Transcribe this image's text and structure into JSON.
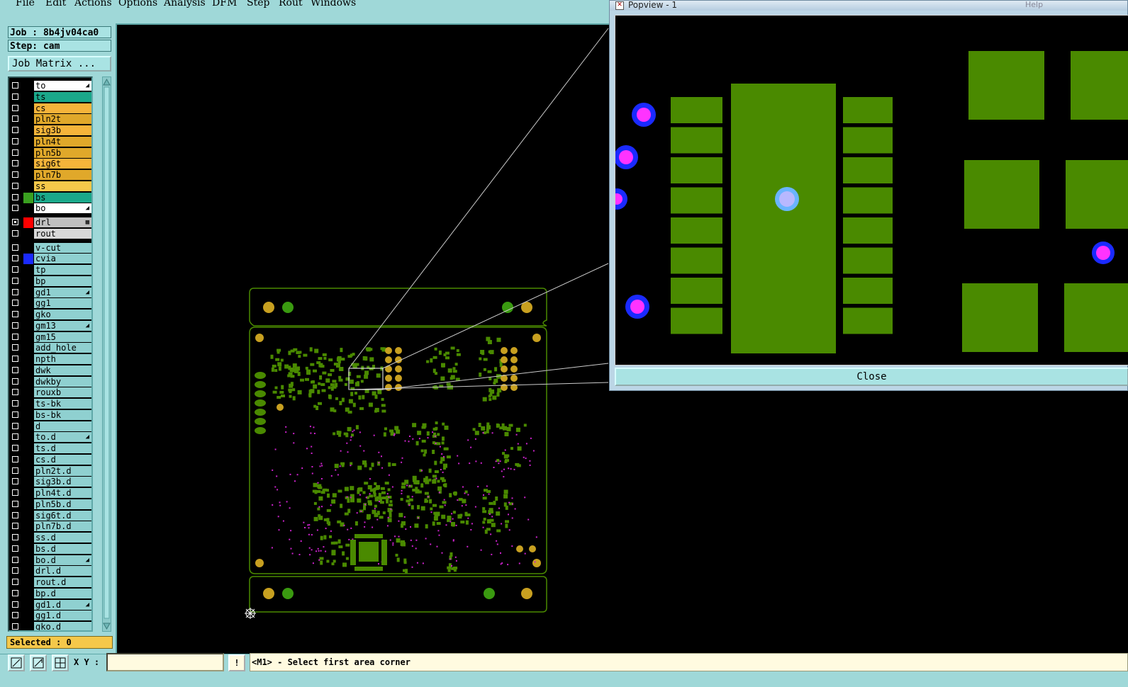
{
  "menu": [
    "File",
    "Edit",
    "Actions",
    "Options",
    "Analysis",
    "DFM",
    "Step",
    "Rout",
    "Windows"
  ],
  "job_label": "Job : 8b4jv04ca0",
  "step_label": "Step: cam",
  "job_matrix_label": "Job Matrix ...",
  "layers_board": [
    {
      "name": "to",
      "color": "#ffffff",
      "swatch": "#000000",
      "mark": "◢",
      "checked": false
    },
    {
      "name": "ts",
      "color": "#1aa88a",
      "swatch": "#000000",
      "mark": "",
      "checked": false
    },
    {
      "name": "cs",
      "color": "#f5b43a",
      "swatch": "#000000",
      "mark": "",
      "checked": false
    },
    {
      "name": "pln2t",
      "color": "#e0a82a",
      "swatch": "#000000",
      "mark": "",
      "checked": false
    },
    {
      "name": "sig3b",
      "color": "#f5b43a",
      "swatch": "#000000",
      "mark": "",
      "checked": false
    },
    {
      "name": "pln4t",
      "color": "#e0a82a",
      "swatch": "#000000",
      "mark": "",
      "checked": false
    },
    {
      "name": "pln5b",
      "color": "#e0a82a",
      "swatch": "#000000",
      "mark": "",
      "checked": false
    },
    {
      "name": "sig6t",
      "color": "#f5b43a",
      "swatch": "#000000",
      "mark": "",
      "checked": false
    },
    {
      "name": "pln7b",
      "color": "#e0a82a",
      "swatch": "#000000",
      "mark": "",
      "checked": false
    },
    {
      "name": "ss",
      "color": "#f5c84a",
      "swatch": "#000000",
      "mark": "",
      "checked": false
    },
    {
      "name": "bs",
      "color": "#1aa88a",
      "swatch": "#3aa020",
      "mark": "",
      "checked": false
    },
    {
      "name": "bo",
      "color": "#ffffff",
      "swatch": "#000000",
      "mark": "◢",
      "checked": false
    }
  ],
  "layers_drill": [
    {
      "name": "drl",
      "color": "#c0c0c0",
      "swatch": "#ff0000",
      "mark": "▦",
      "checked": true
    },
    {
      "name": "rout",
      "color": "#d8d8d8",
      "swatch": "#000000",
      "mark": "",
      "checked": false
    }
  ],
  "layers_misc": [
    {
      "name": "v-cut",
      "mark": "",
      "swatch": "#000000"
    },
    {
      "name": "cvia",
      "mark": "",
      "swatch": "#1a2aff"
    },
    {
      "name": "tp",
      "mark": "",
      "swatch": "#000000"
    },
    {
      "name": "bp",
      "mark": "",
      "swatch": "#000000"
    },
    {
      "name": "gd1",
      "mark": "◢",
      "swatch": "#000000"
    },
    {
      "name": "gg1",
      "mark": "",
      "swatch": "#000000"
    },
    {
      "name": "gko",
      "mark": "",
      "swatch": "#000000"
    },
    {
      "name": "gm13",
      "mark": "◢",
      "swatch": "#000000"
    },
    {
      "name": "gm15",
      "mark": "",
      "swatch": "#000000"
    },
    {
      "name": "add_hole",
      "mark": "",
      "swatch": "#000000"
    },
    {
      "name": "npth",
      "mark": "",
      "swatch": "#000000"
    },
    {
      "name": "dwk",
      "mark": "",
      "swatch": "#000000"
    },
    {
      "name": "dwkby",
      "mark": "",
      "swatch": "#000000"
    },
    {
      "name": "rouxb",
      "mark": "",
      "swatch": "#000000"
    },
    {
      "name": "ts-bk",
      "mark": "",
      "swatch": "#000000"
    },
    {
      "name": "bs-bk",
      "mark": "",
      "swatch": "#000000"
    },
    {
      "name": "d",
      "mark": "",
      "swatch": "#000000"
    },
    {
      "name": "to.d",
      "mark": "◢",
      "swatch": "#000000"
    },
    {
      "name": "ts.d",
      "mark": "",
      "swatch": "#000000"
    },
    {
      "name": "cs.d",
      "mark": "",
      "swatch": "#000000"
    },
    {
      "name": "pln2t.d",
      "mark": "",
      "swatch": "#000000"
    },
    {
      "name": "sig3b.d",
      "mark": "",
      "swatch": "#000000"
    },
    {
      "name": "pln4t.d",
      "mark": "",
      "swatch": "#000000"
    },
    {
      "name": "pln5b.d",
      "mark": "",
      "swatch": "#000000"
    },
    {
      "name": "sig6t.d",
      "mark": "",
      "swatch": "#000000"
    },
    {
      "name": "pln7b.d",
      "mark": "",
      "swatch": "#000000"
    },
    {
      "name": "ss.d",
      "mark": "",
      "swatch": "#000000"
    },
    {
      "name": "bs.d",
      "mark": "",
      "swatch": "#000000"
    },
    {
      "name": "bo.d",
      "mark": "◢",
      "swatch": "#000000"
    },
    {
      "name": "drl.d",
      "mark": "",
      "swatch": "#000000"
    },
    {
      "name": "rout.d",
      "mark": "",
      "swatch": "#000000"
    },
    {
      "name": "bp.d",
      "mark": "",
      "swatch": "#000000"
    },
    {
      "name": "gd1.d",
      "mark": "◢",
      "swatch": "#000000"
    },
    {
      "name": "gg1.d",
      "mark": "",
      "swatch": "#000000"
    },
    {
      "name": "gko.d",
      "mark": "",
      "swatch": "#000000"
    }
  ],
  "selected_label": "Selected : 0",
  "xy_label": "X Y :",
  "xy_value": "",
  "info_button": "!",
  "prompt": "<M1> - Select first area corner",
  "popview": {
    "title": "Popview - 1",
    "help": "Help",
    "close_label": "Close"
  },
  "colors": {
    "pad": "#4a8a00",
    "board_outline": "#4a8a00",
    "via_outer": "#1a2aff",
    "via_inner": "#ff33ff",
    "gold": "#c8a020",
    "panel": "#9fd8d8"
  }
}
